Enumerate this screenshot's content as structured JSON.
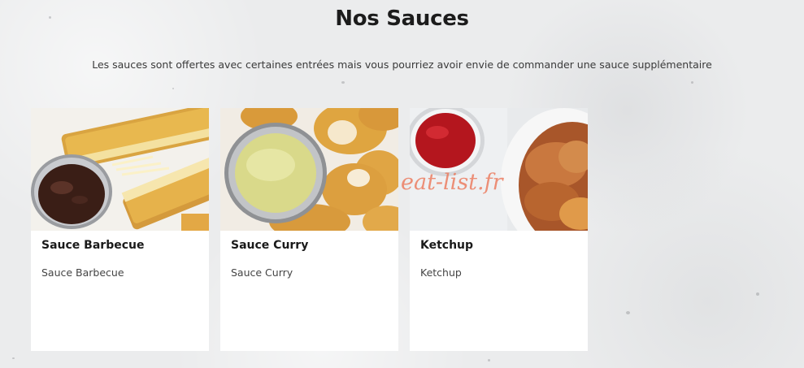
{
  "section": {
    "title": "Nos Sauces",
    "subtitle": "Les sauces sont offertes avec certaines entrées mais vous pourriez avoir envie de commander une sauce supplémentaire"
  },
  "cards": [
    {
      "title": "Sauce Barbecue",
      "description": "Sauce Barbecue",
      "image_icon": "barbecue-sauce-image"
    },
    {
      "title": "Sauce Curry",
      "description": "Sauce Curry",
      "image_icon": "curry-sauce-image"
    },
    {
      "title": "Ketchup",
      "description": "Ketchup",
      "image_icon": "ketchup-image"
    }
  ],
  "watermark": "eat-list.fr",
  "colors": {
    "background": "#ebeced",
    "card": "#ffffff",
    "watermark": "#eb785a"
  }
}
